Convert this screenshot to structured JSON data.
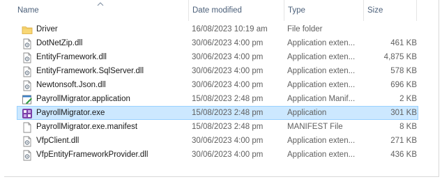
{
  "header": {
    "name": "Name",
    "date_modified": "Date modified",
    "type": "Type",
    "size": "Size"
  },
  "files": [
    {
      "name": "Driver",
      "date": "16/08/2023 10:19 am",
      "type": "File folder",
      "size": "",
      "icon": "folder-icon"
    },
    {
      "name": "DotNetZip.dll",
      "date": "30/06/2023 4:00 pm",
      "type": "Application exten...",
      "size": "461 KB",
      "icon": "dll-file-icon"
    },
    {
      "name": "EntityFramework.dll",
      "date": "30/06/2023 4:00 pm",
      "type": "Application exten...",
      "size": "4,875 KB",
      "icon": "dll-file-icon"
    },
    {
      "name": "EntityFramework.SqlServer.dll",
      "date": "30/06/2023 4:00 pm",
      "type": "Application exten...",
      "size": "578 KB",
      "icon": "dll-file-icon"
    },
    {
      "name": "Newtonsoft.Json.dll",
      "date": "30/06/2023 4:00 pm",
      "type": "Application exten...",
      "size": "696 KB",
      "icon": "dll-file-icon"
    },
    {
      "name": "PayrollMigrator.application",
      "date": "15/08/2023 2:48 pm",
      "type": "Application Manif...",
      "size": "2 KB",
      "icon": "application-manifest-icon"
    },
    {
      "name": "PayrollMigrator.exe",
      "date": "15/08/2023 2:48 pm",
      "type": "Application",
      "size": "301 KB",
      "icon": "exe-app-icon",
      "selected": true
    },
    {
      "name": "PayrollMigrator.exe.manifest",
      "date": "15/08/2023 2:48 pm",
      "type": "MANIFEST File",
      "size": "8 KB",
      "icon": "blank-file-icon"
    },
    {
      "name": "VfpClient.dll",
      "date": "30/06/2023 4:00 pm",
      "type": "Application exten...",
      "size": "271 KB",
      "icon": "dll-file-icon"
    },
    {
      "name": "VfpEntityFrameworkProvider.dll",
      "date": "30/06/2023 4:00 pm",
      "type": "Application exten...",
      "size": "436 KB",
      "icon": "dll-file-icon"
    }
  ],
  "colors": {
    "selection_bg": "#cce8ff",
    "selection_border": "#99d1ff",
    "header_text": "#4c607a",
    "folder": "#f8d775"
  }
}
